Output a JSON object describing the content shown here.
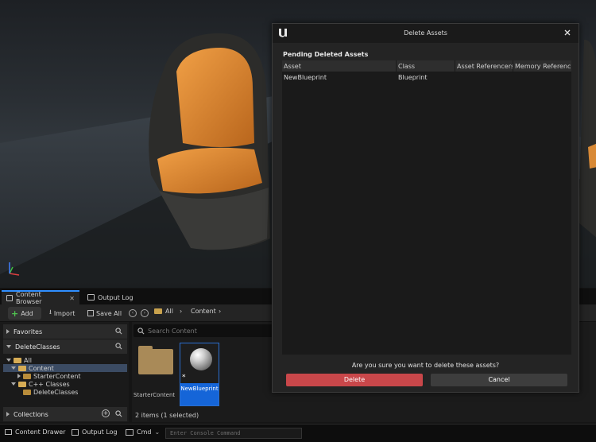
{
  "colors": {
    "accent": "#2f8fff",
    "delete_button": "#c9474a",
    "selection": "#1565d8",
    "folder": "#c9a24d"
  },
  "tabs": [
    {
      "label": "Content Browser",
      "icon": "content-browser-icon"
    },
    {
      "label": "Output Log",
      "icon": "output-log-icon"
    }
  ],
  "toolbar": {
    "add_label": "Add",
    "import_label": "Import",
    "save_all_label": "Save All",
    "breadcrumb": [
      "All",
      "Content"
    ]
  },
  "left_panel": {
    "favorites": "Favorites",
    "project": "DeleteClasses",
    "tree": [
      {
        "label": "All",
        "depth": 0
      },
      {
        "label": "Content",
        "depth": 1
      },
      {
        "label": "StarterContent",
        "depth": 2
      },
      {
        "label": "C++ Classes",
        "depth": 1
      },
      {
        "label": "DeleteClasses",
        "depth": 2
      }
    ],
    "collections": "Collections"
  },
  "content": {
    "search_placeholder": "Search Content",
    "items": [
      {
        "label": "StarterContent",
        "type": "folder"
      },
      {
        "label": "NewBlueprint",
        "type": "blueprint",
        "selected": true
      }
    ],
    "status": "2 items (1 selected)"
  },
  "statusbar": {
    "content_drawer": "Content Drawer",
    "output_log": "Output Log",
    "cmd": "Cmd",
    "console_placeholder": "Enter Console Command"
  },
  "dialog": {
    "title": "Delete Assets",
    "section": "Pending Deleted Assets",
    "columns": [
      "Asset",
      "Class",
      "Asset Referencers",
      "Memory References"
    ],
    "rows": [
      {
        "asset": "NewBlueprint",
        "class": "Blueprint"
      }
    ],
    "question": "Are you sure you want to delete these assets?",
    "delete_label": "Delete",
    "cancel_label": "Cancel"
  }
}
